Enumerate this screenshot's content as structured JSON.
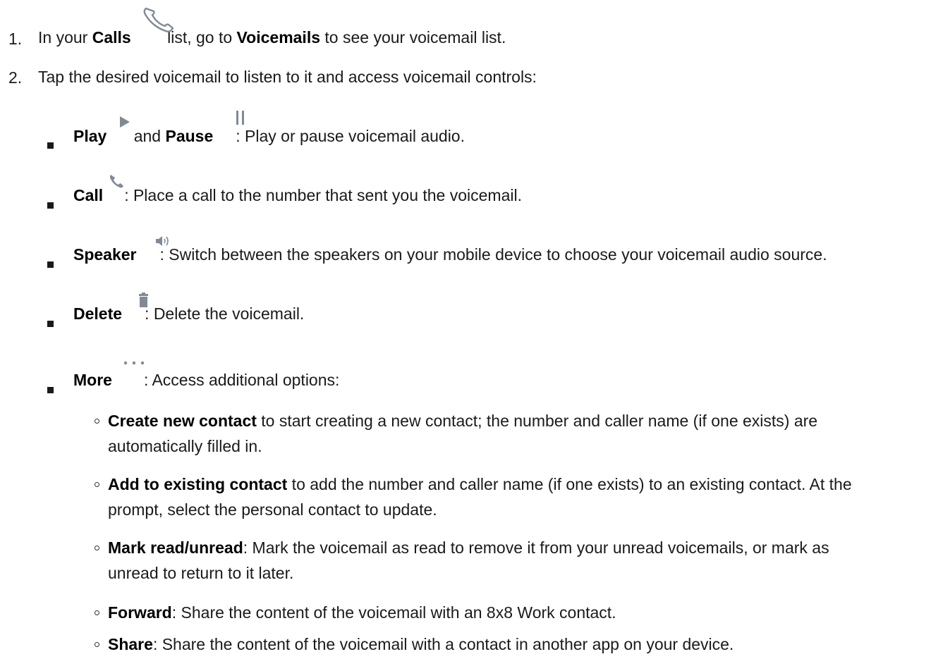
{
  "steps": [
    {
      "number": "1.",
      "pre": "In your ",
      "bold1": "Calls",
      "mid": " list, go to ",
      "bold2": "Voicemails",
      "post": " to see your voicemail list."
    },
    {
      "number": "2.",
      "text": "Tap the desired voicemail to listen to it and access voicemail controls:"
    }
  ],
  "controls": {
    "play": {
      "label": "Play",
      "and": " and ",
      "pause_label": "Pause",
      "desc": ": Play or pause voicemail audio."
    },
    "call": {
      "label": "Call",
      "desc": ": Place a call to the number that sent you the voicemail."
    },
    "speaker": {
      "label": "Speaker",
      "desc": ": Switch between the speakers on your mobile device to choose your voicemail audio source."
    },
    "delete": {
      "label": "Delete",
      "desc": ": Delete the voicemail."
    },
    "more": {
      "label": "More",
      "desc": ": Access additional options:"
    }
  },
  "more_options": [
    {
      "label": "Create new contact",
      "desc_line1": " to start creating a new contact; the number and caller name (if one exists) are",
      "desc_line2": "automatically filled in."
    },
    {
      "label": "Add to existing contact",
      "desc_line1": " to add the number and caller name (if one exists) to an existing contact. At the",
      "desc_line2": "prompt, select the personal contact to update."
    },
    {
      "label": "Mark read/unread",
      "desc_line1": ": Mark the voicemail as read to remove it from your unread voicemails, or mark as",
      "desc_line2": "unread to return to it later."
    },
    {
      "label": "Forward",
      "desc_line1": ": Share the content of the voicemail with an 8x8 Work contact."
    },
    {
      "label": "Share",
      "desc_line1": ": Share the content of the voicemail with a contact in another app on your device."
    }
  ],
  "icons": {
    "calls": "phone-outline-icon",
    "play": "play-icon",
    "pause": "pause-icon",
    "call": "phone-icon",
    "speaker": "speaker-icon",
    "delete": "trash-icon",
    "more": "more-dots-icon"
  },
  "colors": {
    "icon_gray": "#7f8a94",
    "text": "#1a1a1a"
  }
}
